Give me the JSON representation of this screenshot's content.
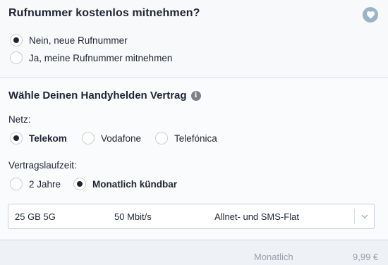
{
  "porting": {
    "title": "Rufnummer kostenlos mitnehmen?",
    "options": [
      {
        "label": "Nein, neue Rufnummer",
        "selected": true
      },
      {
        "label": "Ja, meine Rufnummer mitnehmen",
        "selected": false
      }
    ]
  },
  "contract": {
    "title": "Wähle Deinen Handyhelden Vertrag",
    "info_icon": "i",
    "network_label": "Netz:",
    "networks": [
      {
        "label": "Telekom",
        "selected": true
      },
      {
        "label": "Vodafone",
        "selected": false
      },
      {
        "label": "Telefónica",
        "selected": false
      }
    ],
    "term_label": "Vertragslaufzeit:",
    "terms": [
      {
        "label": "2 Jahre",
        "selected": false
      },
      {
        "label": "Monatlich kündbar",
        "selected": true
      }
    ],
    "tariff_select": {
      "data": "25 GB 5G",
      "speed": "50 Mbit/s",
      "flat": "Allnet- und SMS-Flat"
    }
  },
  "footer": {
    "label": "Monatlich",
    "price": "9,99 €"
  },
  "icons": [
    "heart-icon",
    "info-icon",
    "chevron-down-icon"
  ],
  "colors": {
    "accent_dark": "#1f2433",
    "heart_bg": "#9bb3c7",
    "muted": "#9aa1ab"
  }
}
